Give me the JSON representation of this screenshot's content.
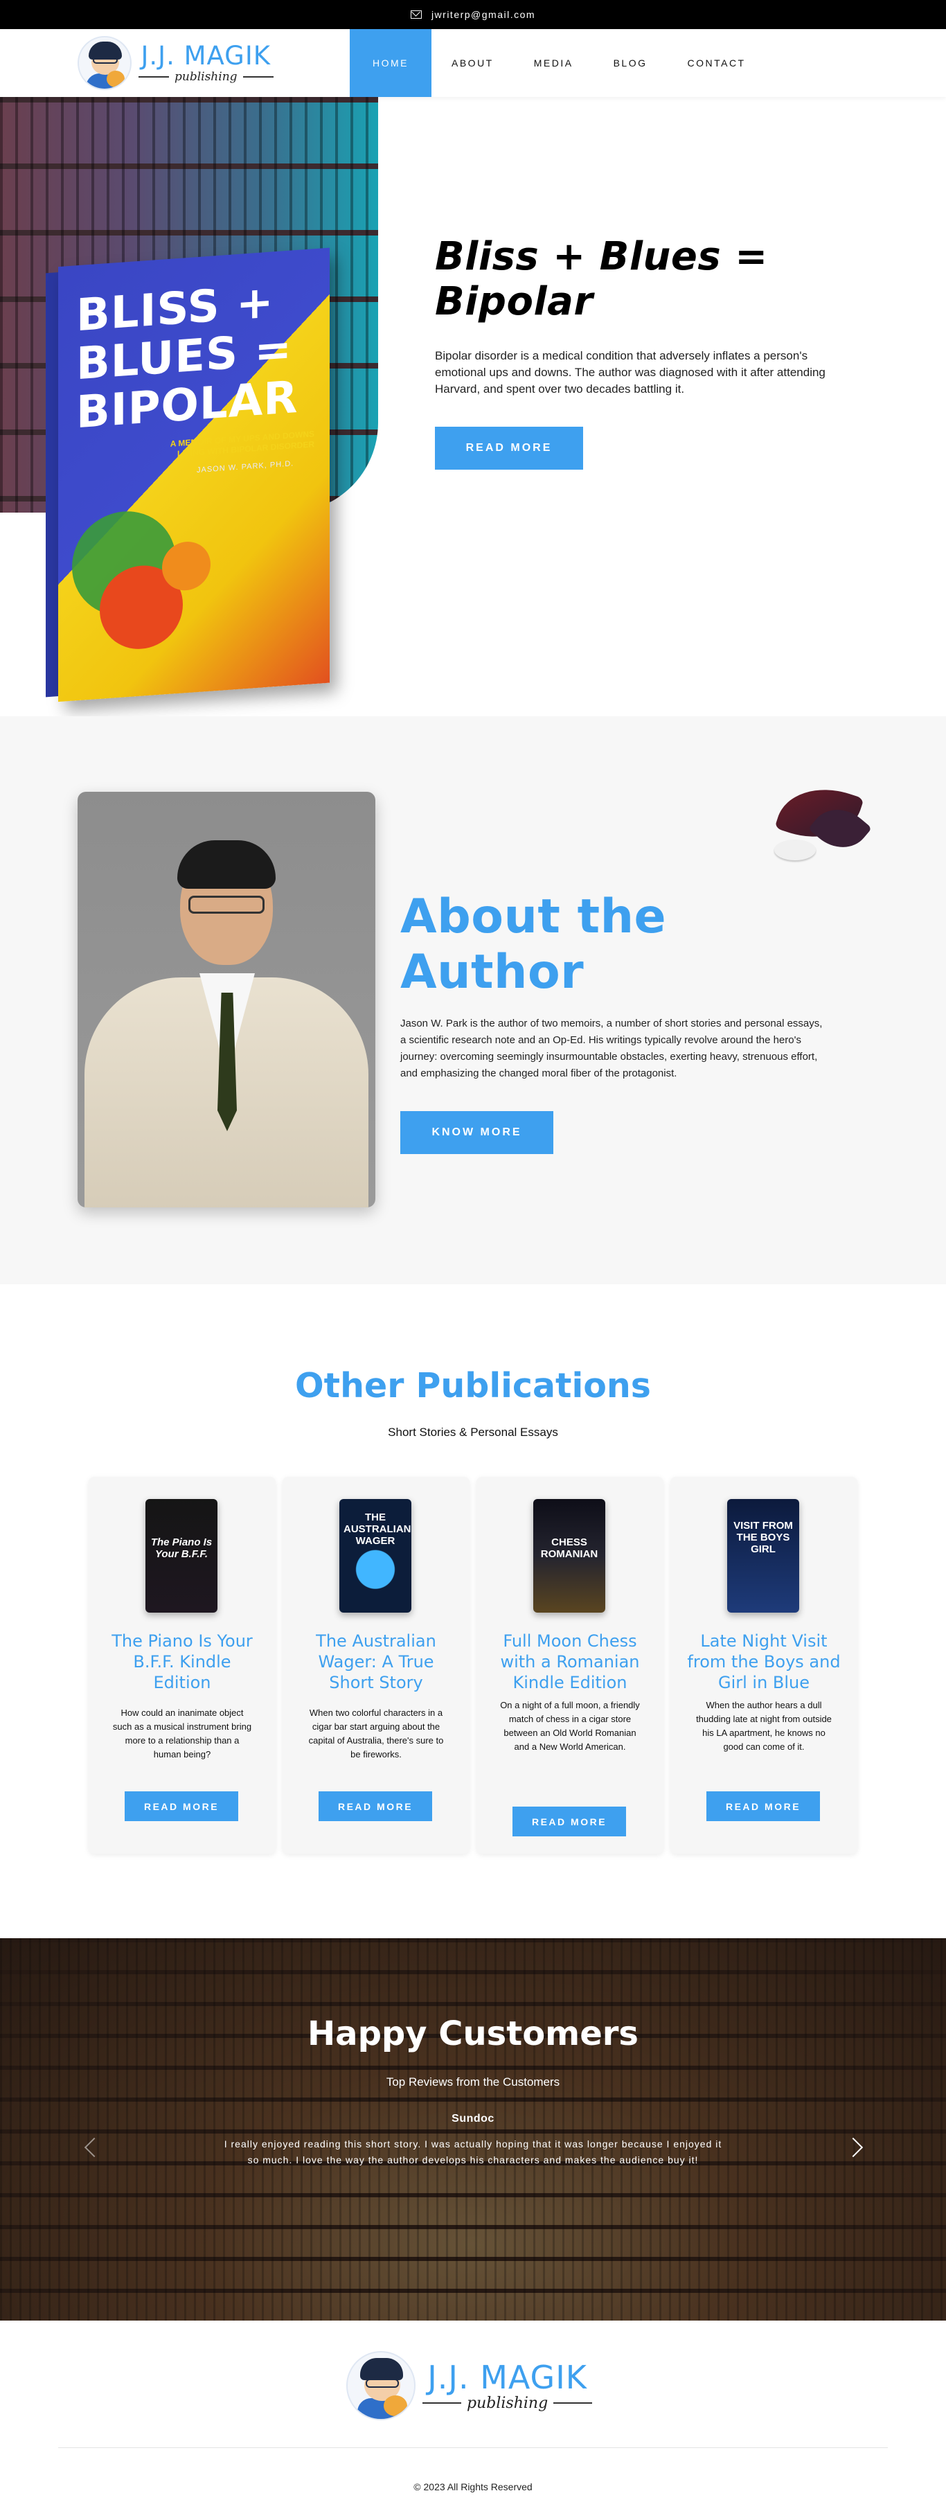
{
  "topbar": {
    "email": "jwriterp@gmail.com"
  },
  "brand": {
    "name": "J.J. MAGIK",
    "tagline": "publishing"
  },
  "nav": {
    "items": [
      "HOME",
      "ABOUT",
      "MEDIA",
      "BLOG",
      "CONTACT"
    ],
    "active": "HOME"
  },
  "hero": {
    "title": "Bliss + Blues = Bipolar",
    "description": "Bipolar disorder is a medical condition that adversely inflates a person's emotional ups and downs. The author was diagnosed with it after attending Harvard, and spent over two decades battling it.",
    "button": "READ MORE",
    "book": {
      "title_lines": [
        "BLISS +",
        "BLUES =",
        "BIPOLAR"
      ],
      "subtitle": "A MEMOIR OF MY UPS AND DOWNS LIVING WITH BIPOLAR DISORDER",
      "author": "JASON W. PARK, PH.D."
    }
  },
  "about": {
    "title": "About the Author",
    "description": "Jason W. Park is the author of two memoirs, a number of short stories and personal essays, a scientific research note and an Op-Ed. His writings typically revolve around the hero's journey: overcoming seemingly insurmountable obstacles, exerting heavy, strenuous effort, and emphasizing the changed moral fiber of the protagonist.",
    "button": "KNOW MORE"
  },
  "publications": {
    "title": "Other Publications",
    "subtitle": "Short Stories & Personal Essays",
    "items": [
      {
        "title": "The Piano Is Your B.F.F. Kindle Edition",
        "description": "How could an inanimate object such as a musical instrument bring more to a relationship than a human being?",
        "button": "READ MORE",
        "cover_text": "The Piano Is Your B.F.F."
      },
      {
        "title": "The Australian Wager: A True Short Story",
        "description": "When two colorful characters in a cigar bar start arguing about the capital of Australia, there's sure to be fireworks.",
        "button": "READ MORE",
        "cover_text": "THE AUSTRALIAN WAGER"
      },
      {
        "title": "Full Moon Chess with a Romanian Kindle Edition",
        "description": "On a night of a full moon, a friendly match of chess in a cigar store between an Old World Romanian and a New World American.",
        "button": "READ MORE",
        "cover_text": "CHESS ROMANIAN"
      },
      {
        "title": "Late Night Visit from the Boys and Girl in Blue",
        "description": "When the author hears a dull thudding late at night from outside his LA apartment, he knows no good can come of it.",
        "button": "READ MORE",
        "cover_text": "VISIT FROM THE BOYS GIRL"
      }
    ]
  },
  "testimonials": {
    "title": "Happy Customers",
    "subtitle": "Top Reviews from the Customers",
    "name": "Sundoc",
    "quote": "I really enjoyed reading this short story. I was actually hoping that it was longer because I enjoyed it so much. I love the way the author develops his characters and makes the audience buy it!"
  },
  "footer": {
    "copyright": "© 2023 All Rights Reserved"
  },
  "colors": {
    "accent": "#3ea0ef",
    "topbar": "#000000",
    "section_bg": "#f7f7f7"
  }
}
